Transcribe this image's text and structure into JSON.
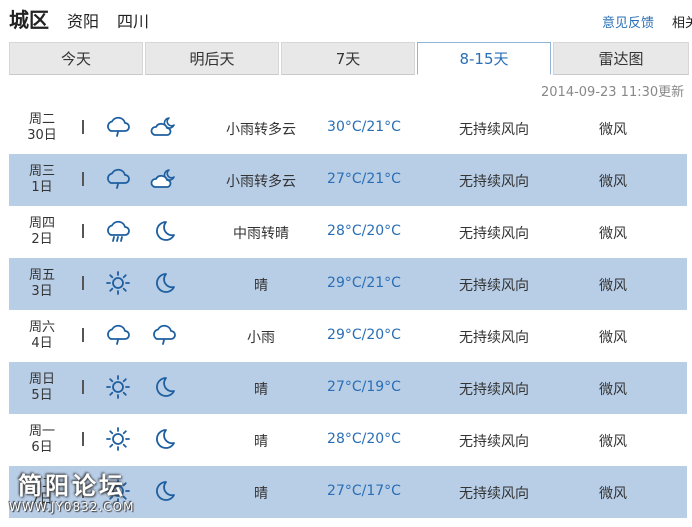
{
  "header": {
    "city": "城区",
    "county": "资阳",
    "province": "四川",
    "feedback_label": "意见反馈",
    "related_label": "相关"
  },
  "tabs": [
    {
      "label": "今天",
      "active": false
    },
    {
      "label": "明后天",
      "active": false
    },
    {
      "label": "7天",
      "active": false
    },
    {
      "label": "8-15天",
      "active": true
    },
    {
      "label": "雷达图",
      "active": false
    }
  ],
  "updated": "2014-09-23 11:30更新",
  "forecast": [
    {
      "weekday": "周二",
      "date": "30日",
      "day_icon": "light-rain-icon",
      "night_icon": "partly-cloudy-night-icon",
      "condition": "小雨转多云",
      "temp": "30°C/21°C",
      "wind": "无持续风向",
      "force": "微风"
    },
    {
      "weekday": "周三",
      "date": "1日",
      "day_icon": "light-rain-icon",
      "night_icon": "partly-cloudy-night-icon",
      "condition": "小雨转多云",
      "temp": "27°C/21°C",
      "wind": "无持续风向",
      "force": "微风"
    },
    {
      "weekday": "周四",
      "date": "2日",
      "day_icon": "moderate-rain-icon",
      "night_icon": "moon-icon",
      "condition": "中雨转晴",
      "temp": "28°C/20°C",
      "wind": "无持续风向",
      "force": "微风"
    },
    {
      "weekday": "周五",
      "date": "3日",
      "day_icon": "sun-icon",
      "night_icon": "moon-icon",
      "condition": "晴",
      "temp": "29°C/21°C",
      "wind": "无持续风向",
      "force": "微风"
    },
    {
      "weekday": "周六",
      "date": "4日",
      "day_icon": "light-rain-icon",
      "night_icon": "light-rain-icon",
      "condition": "小雨",
      "temp": "29°C/20°C",
      "wind": "无持续风向",
      "force": "微风"
    },
    {
      "weekday": "周日",
      "date": "5日",
      "day_icon": "sun-icon",
      "night_icon": "moon-icon",
      "condition": "晴",
      "temp": "27°C/19°C",
      "wind": "无持续风向",
      "force": "微风"
    },
    {
      "weekday": "周一",
      "date": "6日",
      "day_icon": "sun-icon",
      "night_icon": "moon-icon",
      "condition": "晴",
      "temp": "28°C/20°C",
      "wind": "无持续风向",
      "force": "微风"
    },
    {
      "weekday": "周二",
      "date": "7日",
      "day_icon": "sun-icon",
      "night_icon": "moon-icon",
      "condition": "晴",
      "temp": "27°C/17°C",
      "wind": "无持续风向",
      "force": "微风"
    }
  ],
  "watermark": {
    "title": "简阳论坛",
    "url": "WWW.JY0832.COM"
  },
  "colors": {
    "accent": "#2a6fb5",
    "row_alt_bg": "#b8cde6",
    "icon_stroke": "#1e5fa0"
  }
}
